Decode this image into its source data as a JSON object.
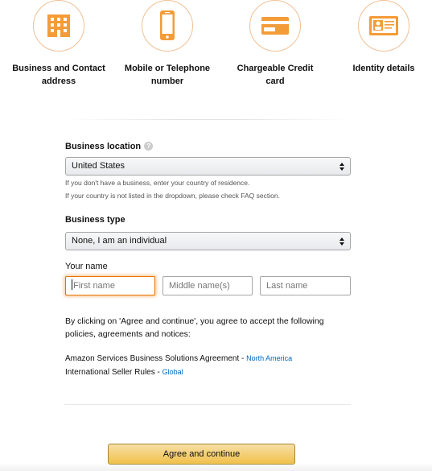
{
  "requirements": [
    {
      "label": "Business and Contact address",
      "icon": "building-icon"
    },
    {
      "label": "Mobile or Telephone number",
      "icon": "mobile-phone-icon"
    },
    {
      "label": "Chargeable Credit card",
      "icon": "credit-card-icon"
    },
    {
      "label": "Identity details",
      "icon": "id-card-icon"
    }
  ],
  "colors": {
    "accent": "#f39c38",
    "link": "#0066c0",
    "focus": "#e77600",
    "button": "#f0c14b"
  },
  "form": {
    "business_location": {
      "label": "Business location",
      "selected": "United States",
      "hint1": "If you don't have a business, enter your country of residence.",
      "hint2": "If your country is not listed in the dropdown, please check FAQ section."
    },
    "business_type": {
      "label": "Business type",
      "selected": "None, I am an individual"
    },
    "your_name": {
      "label": "Your name",
      "first_placeholder": "First name",
      "middle_placeholder": "Middle name(s)",
      "last_placeholder": "Last name"
    }
  },
  "policies": {
    "intro": "By clicking on 'Agree and continue', you agree to accept the following policies, agreements and notices:",
    "items": [
      {
        "text": "Amazon Services Business Solutions Agreement - ",
        "link": "North America"
      },
      {
        "text": "International Seller Rules - ",
        "link": "Global"
      }
    ]
  },
  "submit_label": "Agree and continue"
}
